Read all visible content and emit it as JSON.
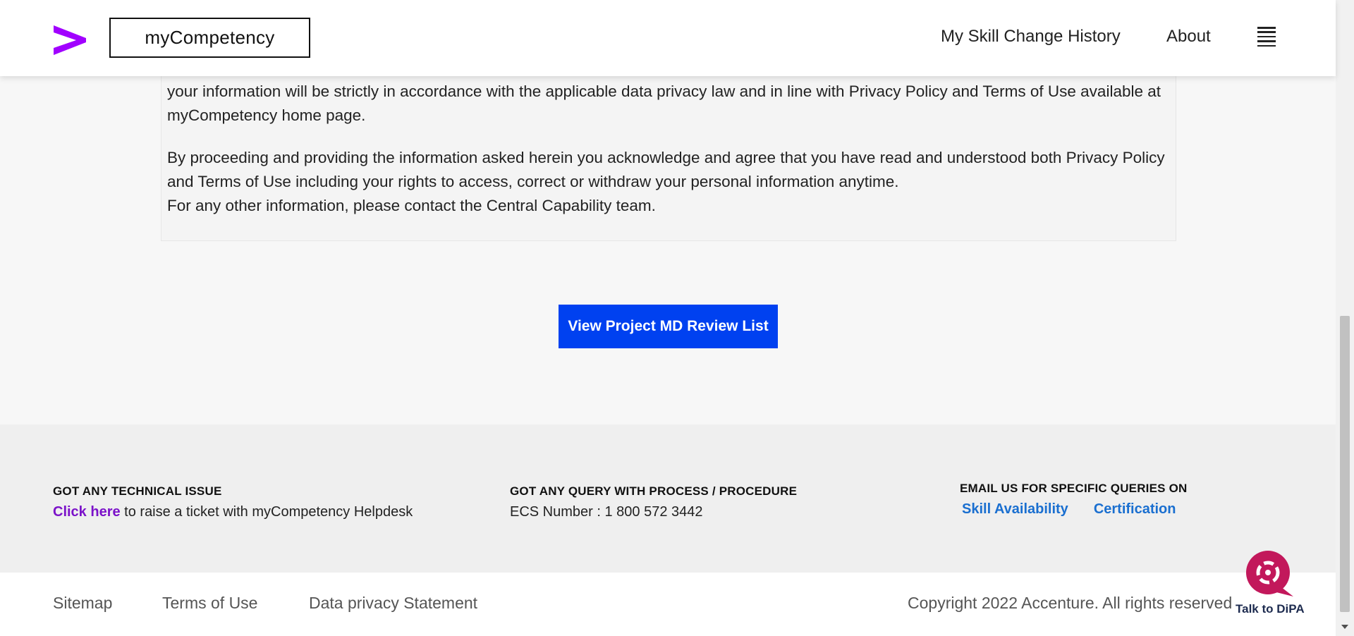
{
  "header": {
    "brand": "myCompetency",
    "nav": [
      {
        "label": "My Skill Change History"
      },
      {
        "label": "About"
      }
    ]
  },
  "content": {
    "paragraph1": "your information will be strictly in accordance with the applicable data privacy law and in line with Privacy Policy and Terms of Use available at myCompetency home page.",
    "paragraph2_line1": "By proceeding and providing the information asked herein you acknowledge and agree that you have read and understood both Privacy Policy and Terms of Use including your rights to access, correct or withdraw your personal information anytime.",
    "paragraph2_line2": "For any other information, please contact the Central Capability team.",
    "button_label": "View Project MD Review List"
  },
  "footer": {
    "technical": {
      "title": "GOT ANY TECHNICAL ISSUE",
      "link": "Click here",
      "text": " to raise a ticket with myCompetency Helpdesk"
    },
    "query": {
      "title": "GOT ANY QUERY WITH PROCESS / PROCEDURE",
      "text": "ECS Number : 1 800 572 3442"
    },
    "email": {
      "title": "EMAIL US FOR SPECIFIC QUERIES ON",
      "links": [
        "Skill Availability",
        "Certification"
      ]
    },
    "bottom_links": [
      "Sitemap",
      "Terms of Use",
      "Data privacy Statement"
    ],
    "copyright": "Copyright 2022 Accenture. All rights reserved"
  },
  "chat": {
    "label": "Talk to DiPA"
  },
  "colors": {
    "brand_purple": "#a100ff",
    "button_blue": "#0041f0",
    "link_purple": "#7b12c9",
    "link_blue": "#1a6fd0",
    "chat_pink": "#c2185b"
  }
}
